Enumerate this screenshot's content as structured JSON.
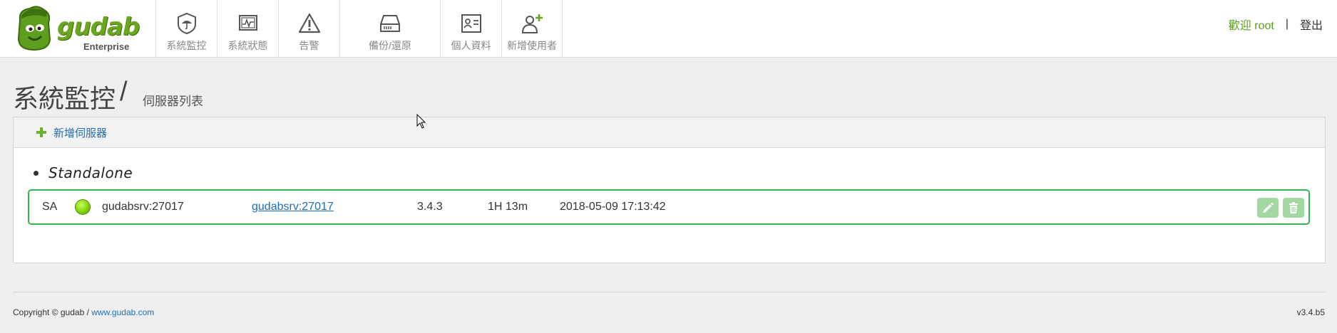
{
  "brand": {
    "name": "gudab",
    "edition": "Enterprise"
  },
  "nav": [
    {
      "label": "系統監控",
      "icon": "shield-umbrella-icon"
    },
    {
      "label": "系統狀態",
      "icon": "monitor-chart-icon"
    },
    {
      "label": "告警",
      "icon": "warning-icon"
    },
    {
      "label": "備份/還原",
      "icon": "hard-drive-icon"
    },
    {
      "label": "個人資料",
      "icon": "id-card-icon"
    },
    {
      "label": "新增使用者",
      "icon": "add-user-icon"
    }
  ],
  "user": {
    "welcome": "歡迎 root",
    "separator": "|",
    "logout": "登出"
  },
  "page": {
    "title": "系統監控",
    "slash": "/",
    "subtitle": "伺服器列表"
  },
  "panel": {
    "add_server": "新增伺服器"
  },
  "group": {
    "name": "Standalone"
  },
  "server": {
    "role": "SA",
    "status_color": "#8fdc16",
    "host": "gudabsrv:27017",
    "link": "gudabsrv:27017",
    "version": "3.4.3",
    "uptime": "1H 13m",
    "timestamp": "2018-05-09 17:13:42"
  },
  "footer": {
    "copyright": "Copyright © gudab  / ",
    "site": "www.gudab.com",
    "version": "v3.4.b5"
  },
  "colors": {
    "accent": "#6aa620",
    "link": "#1e6fb5",
    "row_border": "#37b44a"
  }
}
